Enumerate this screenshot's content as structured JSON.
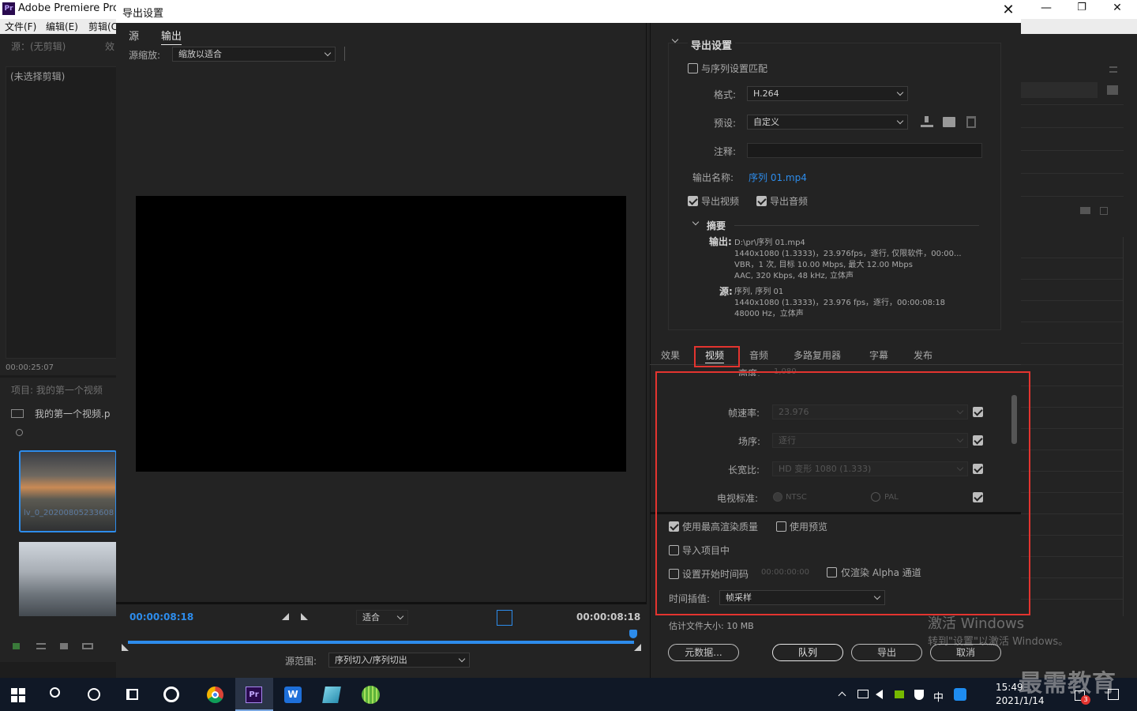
{
  "app": {
    "title": "Adobe Premiere Pro",
    "logo": "Pr",
    "menu": [
      "文件(F)",
      "编辑(E)",
      "剪辑(C"
    ]
  },
  "main_window_controls": [
    "—",
    "❐",
    "✕"
  ],
  "left_panel": {
    "source_tab": "源：(无剪辑)",
    "effects_tab": "效",
    "no_clip": "(未选择剪辑)",
    "timecode": "00:00:25:07",
    "project_tab": "项目: 我的第一个视频",
    "project_item": "我的第一个视频.p",
    "clip1_name": "lv_0_20200805233608"
  },
  "dialog": {
    "title": "导出设置",
    "tabs": [
      "源",
      "输出"
    ],
    "source_scaling_label": "源缩放:",
    "source_scaling_value": "缩放以适合",
    "timecode_left": "00:00:08:18",
    "timecode_right": "00:00:08:18",
    "fit_value": "适合",
    "source_range_label": "源范围:",
    "source_range_value": "序列切入/序列切出",
    "export_settings_header": "导出设置",
    "match_sequence": "与序列设置匹配",
    "format_label": "格式:",
    "format_value": "H.264",
    "preset_label": "预设:",
    "preset_value": "自定义",
    "comment_label": "注释:",
    "output_name_label": "输出名称:",
    "output_name_value": "序列 01.mp4",
    "export_video": "导出视频",
    "export_audio": "导出音频",
    "summary_header": "摘要",
    "summary_output_label": "输出:",
    "summary_output_lines": [
      "D:\\pr\\序列 01.mp4",
      "1440x1080 (1.3333)，23.976fps，逐行, 仅限软件，00:00...",
      "VBR，1 次, 目标 10.00 Mbps, 最大 12.00 Mbps",
      "AAC, 320 Kbps, 48  kHz, 立体声"
    ],
    "summary_source_label": "源:",
    "summary_source_lines": [
      "序列, 序列 01",
      "1440x1080 (1.3333)，23.976 fps，逐行，00:00:08:18",
      "48000 Hz，立体声"
    ],
    "settings_tabs": [
      "效果",
      "视频",
      "音频",
      "多路复用器",
      "字幕",
      "发布"
    ],
    "video": {
      "height_label": "高度:",
      "height_value": "1,080",
      "framerate_label": "帧速率:",
      "framerate_value": "23.976",
      "field_order_label": "场序:",
      "field_order_value": "逐行",
      "aspect_label": "长宽比:",
      "aspect_value": "HD 变形 1080 (1.333)",
      "tv_standard_label": "电视标准:",
      "ntsc": "NTSC",
      "pal": "PAL"
    },
    "max_render_quality": "使用最高渲染质量",
    "use_previews": "使用预览",
    "import_into_project": "导入项目中",
    "set_start_timecode": "设置开始时间码",
    "start_timecode_value": "00:00:00:00",
    "render_alpha_only": "仅渲染 Alpha 通道",
    "time_interpolation_label": "时间插值:",
    "time_interpolation_value": "帧采样",
    "estimated_size": "估计文件大小:  10 MB",
    "buttons": {
      "metadata": "元数据...",
      "queue": "队列",
      "export": "导出",
      "cancel": "取消"
    }
  },
  "watermark": {
    "line1": "激活 Windows",
    "line2": "转到\"设置\"以激活 Windows。",
    "brand": "最需教育"
  },
  "taskbar": {
    "time": "15:49",
    "date": "2021/1/14",
    "ime": "中",
    "notif_count": "3"
  },
  "colors": {
    "accent": "#2d8ceb",
    "annotation": "#e3342f",
    "premiere": "#2a0a4f"
  }
}
